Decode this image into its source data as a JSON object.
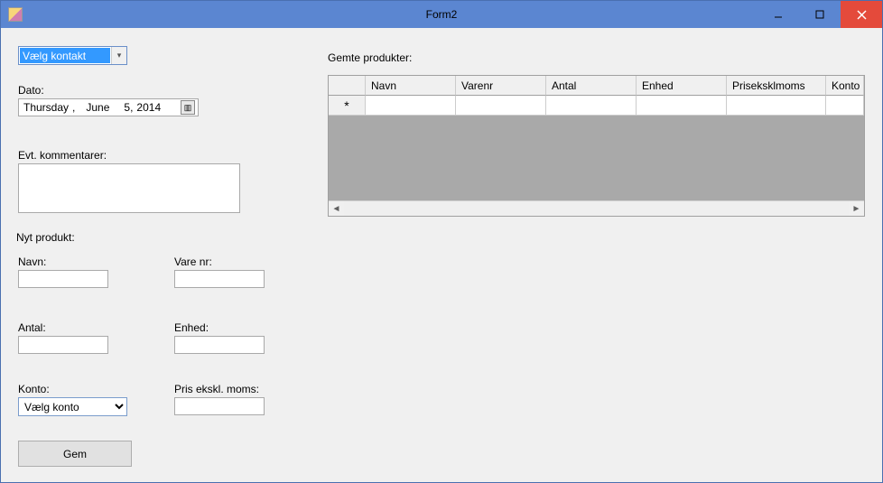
{
  "window": {
    "title": "Form2"
  },
  "contactCombo": {
    "selected": "Vælg kontakt"
  },
  "dateLabel": "Dato:",
  "date": {
    "weekday": "Thursday",
    "sep1": ",",
    "month": "June",
    "day": "5,",
    "year": "2014"
  },
  "commentsLabel": "Evt. kommentarer:",
  "commentsValue": "",
  "newProductLabel": "Nyt produkt:",
  "fields": {
    "navnLabel": "Navn:",
    "navnValue": "",
    "varenrLabel": "Vare nr:",
    "varenrValue": "",
    "antalLabel": "Antal:",
    "antalValue": "",
    "enhedLabel": "Enhed:",
    "enhedValue": "",
    "kontoLabel": "Konto:",
    "kontoSelected": "Vælg konto",
    "prisLabel": "Pris ekskl. moms:",
    "prisValue": ""
  },
  "saveButton": "Gem",
  "savedProductsLabel": "Gemte produkter:",
  "grid": {
    "columns": [
      "Navn",
      "Varenr",
      "Antal",
      "Enhed",
      "Priseksklmoms",
      "Konto"
    ],
    "newRowMarker": "*"
  }
}
